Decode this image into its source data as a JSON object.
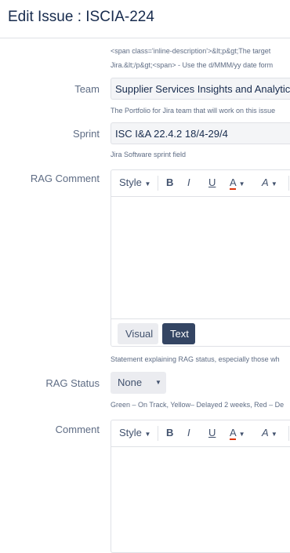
{
  "dialog": {
    "title": "Edit Issue : ISCIA-224"
  },
  "top_description": {
    "line1": "<span class='inline-description'>&lt;p&gt;The target",
    "line2": "Jira.&lt;/p&gt;<span> - Use the d/MMM/yy date form"
  },
  "team": {
    "label": "Team",
    "value": "Supplier Services Insights and Analytics S",
    "description": "The Portfolio for Jira team that will work on this issue"
  },
  "sprint": {
    "label": "Sprint",
    "value": "ISC I&A 22.4.2 18/4-29/4",
    "description": "Jira Software sprint field"
  },
  "rag_comment": {
    "label": "RAG Comment",
    "description": "Statement explaining RAG status, especially those wh"
  },
  "editor_toolbar": {
    "style_label": "Style",
    "bold": "B",
    "italic": "I",
    "underline": "U",
    "text_color": "A",
    "more_formatting": "A",
    "tab_visual": "Visual",
    "tab_text": "Text"
  },
  "rag_status": {
    "label": "RAG Status",
    "value": "None",
    "description": "Green – On Track, Yellow– Delayed 2 weeks, Red – De"
  },
  "comment": {
    "label": "Comment"
  },
  "colors": {
    "text": "#172b4d",
    "muted": "#5e6c84",
    "active_tab": "#344563",
    "text_color_underline": "#de350b"
  },
  "icons": [
    "chevron-down-icon"
  ]
}
